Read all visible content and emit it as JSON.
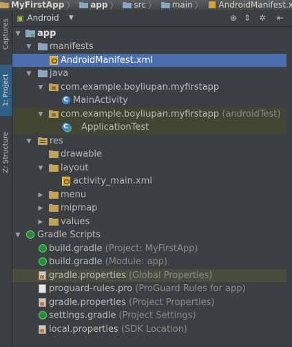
{
  "breadcrumb": [
    {
      "label": "MyFirstApp",
      "icon": "folder"
    },
    {
      "label": "app",
      "icon": "folder"
    },
    {
      "label": "src",
      "icon": "folder"
    },
    {
      "label": "main",
      "icon": "folder"
    },
    {
      "label": "AndroidManifest.xml",
      "icon": "xml-file"
    }
  ],
  "sidebar": {
    "tabs": [
      {
        "label": "Captures",
        "active": false
      },
      {
        "label": "1: Project",
        "active": true
      },
      {
        "label": "Z: Structure",
        "active": false
      }
    ]
  },
  "toolbar": {
    "view_mode": "Android",
    "icons": [
      "target-icon",
      "collapse-icon",
      "gear-icon",
      "hide-icon"
    ]
  },
  "tree": [
    {
      "label": "app",
      "hint": "",
      "icon": "module-folder",
      "expanded": true,
      "bold": true
    },
    {
      "label": "manifests",
      "hint": "",
      "icon": "folder",
      "expanded": true
    },
    {
      "label": "AndroidManifest.xml",
      "hint": "",
      "icon": "xml-file",
      "selected": true
    },
    {
      "label": "java",
      "hint": "",
      "icon": "folder",
      "expanded": true
    },
    {
      "label": "com.example.boyliupan.myfirstapp",
      "hint": "",
      "icon": "package",
      "expanded": true
    },
    {
      "label": "MainActivity",
      "hint": "",
      "icon": "class"
    },
    {
      "label": "com.example.boyliupan.myfirstapp",
      "hint": "(androidTest)",
      "icon": "package",
      "expanded": true
    },
    {
      "label": "ApplicationTest",
      "hint": "",
      "icon": "test-class"
    },
    {
      "label": "res",
      "hint": "",
      "icon": "res-folder",
      "expanded": true
    },
    {
      "label": "drawable",
      "hint": "",
      "icon": "folder"
    },
    {
      "label": "layout",
      "hint": "",
      "icon": "folder",
      "expanded": true
    },
    {
      "label": "activity_main.xml",
      "hint": "",
      "icon": "layout-xml"
    },
    {
      "label": "menu",
      "hint": "",
      "icon": "folder",
      "expanded": false
    },
    {
      "label": "mipmap",
      "hint": "",
      "icon": "folder",
      "expanded": false
    },
    {
      "label": "values",
      "hint": "",
      "icon": "folder",
      "expanded": false
    },
    {
      "label": "Gradle Scripts",
      "hint": "",
      "icon": "gradle",
      "expanded": true
    },
    {
      "label": "build.gradle",
      "hint": "(Project: MyFirstApp)",
      "icon": "gradle"
    },
    {
      "label": "build.gradle",
      "hint": "(Module: app)",
      "icon": "gradle"
    },
    {
      "label": "gradle.properties",
      "hint": "(Global Properties)",
      "icon": "properties"
    },
    {
      "label": "proguard-rules.pro",
      "hint": "(ProGuard Rules for app)",
      "icon": "file"
    },
    {
      "label": "gradle.properties",
      "hint": "(Project Properties)",
      "icon": "properties"
    },
    {
      "label": "settings.gradle",
      "hint": "(Project Settings)",
      "icon": "gradle"
    },
    {
      "label": "local.properties",
      "hint": "(SDK Location)",
      "icon": "properties"
    }
  ]
}
